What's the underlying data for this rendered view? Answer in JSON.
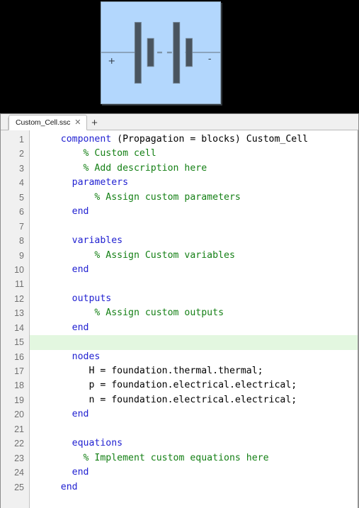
{
  "block_icon": {
    "name": "battery-cell-icon",
    "background_color": "#b3d7fd",
    "border_color": "#8fa8bd",
    "element_color": "#44505c",
    "positive_terminal_label": "+",
    "negative_terminal_label": "-"
  },
  "tabs": {
    "items": [
      {
        "label": "Custom_Cell.ssc",
        "close_glyph": "✕",
        "active": true
      }
    ],
    "new_tab_label": "+"
  },
  "editor": {
    "current_line": 15,
    "colors": {
      "keyword": "#1f1fd1",
      "comment": "#158016",
      "plain": "#000000",
      "highlight": "#e3f7e0",
      "gutter_background": "#f0f0f0",
      "gutter_text": "#707070"
    },
    "lines": [
      {
        "n": "1",
        "tokens": [
          {
            "t": "kw",
            "s": "component"
          },
          {
            "t": "pl",
            "s": " (Propagation = blocks) Custom_Cell"
          }
        ],
        "indent": 4
      },
      {
        "n": "2",
        "tokens": [
          {
            "t": "cm",
            "s": "% Custom cell"
          }
        ],
        "indent": 8
      },
      {
        "n": "3",
        "tokens": [
          {
            "t": "cm",
            "s": "% Add description here"
          }
        ],
        "indent": 8
      },
      {
        "n": "4",
        "tokens": [
          {
            "t": "kw",
            "s": "parameters"
          }
        ],
        "indent": 6
      },
      {
        "n": "5",
        "tokens": [
          {
            "t": "cm",
            "s": "% Assign custom parameters"
          }
        ],
        "indent": 10
      },
      {
        "n": "6",
        "tokens": [
          {
            "t": "kw",
            "s": "end"
          }
        ],
        "indent": 6
      },
      {
        "n": "7",
        "tokens": [],
        "indent": 0
      },
      {
        "n": "8",
        "tokens": [
          {
            "t": "kw",
            "s": "variables"
          }
        ],
        "indent": 6
      },
      {
        "n": "9",
        "tokens": [
          {
            "t": "cm",
            "s": "% Assign Custom variables"
          }
        ],
        "indent": 10
      },
      {
        "n": "10",
        "tokens": [
          {
            "t": "kw",
            "s": "end"
          }
        ],
        "indent": 6
      },
      {
        "n": "11",
        "tokens": [],
        "indent": 0
      },
      {
        "n": "12",
        "tokens": [
          {
            "t": "kw",
            "s": "outputs"
          }
        ],
        "indent": 6
      },
      {
        "n": "13",
        "tokens": [
          {
            "t": "cm",
            "s": "% Assign custom outputs"
          }
        ],
        "indent": 10
      },
      {
        "n": "14",
        "tokens": [
          {
            "t": "kw",
            "s": "end"
          }
        ],
        "indent": 6
      },
      {
        "n": "15",
        "tokens": [],
        "indent": 0
      },
      {
        "n": "16",
        "tokens": [
          {
            "t": "kw",
            "s": "nodes"
          }
        ],
        "indent": 6
      },
      {
        "n": "17",
        "tokens": [
          {
            "t": "pl",
            "s": "H = foundation.thermal.thermal;"
          }
        ],
        "indent": 9
      },
      {
        "n": "18",
        "tokens": [
          {
            "t": "pl",
            "s": "p = foundation.electrical.electrical;"
          }
        ],
        "indent": 9
      },
      {
        "n": "19",
        "tokens": [
          {
            "t": "pl",
            "s": "n = foundation.electrical.electrical;"
          }
        ],
        "indent": 9
      },
      {
        "n": "20",
        "tokens": [
          {
            "t": "kw",
            "s": "end"
          }
        ],
        "indent": 6
      },
      {
        "n": "21",
        "tokens": [],
        "indent": 0
      },
      {
        "n": "22",
        "tokens": [
          {
            "t": "kw",
            "s": "equations"
          }
        ],
        "indent": 6
      },
      {
        "n": "23",
        "tokens": [
          {
            "t": "cm",
            "s": "% Implement custom equations here"
          }
        ],
        "indent": 8
      },
      {
        "n": "24",
        "tokens": [
          {
            "t": "kw",
            "s": "end"
          }
        ],
        "indent": 6
      },
      {
        "n": "25",
        "tokens": [
          {
            "t": "kw",
            "s": "end"
          }
        ],
        "indent": 4
      }
    ]
  }
}
